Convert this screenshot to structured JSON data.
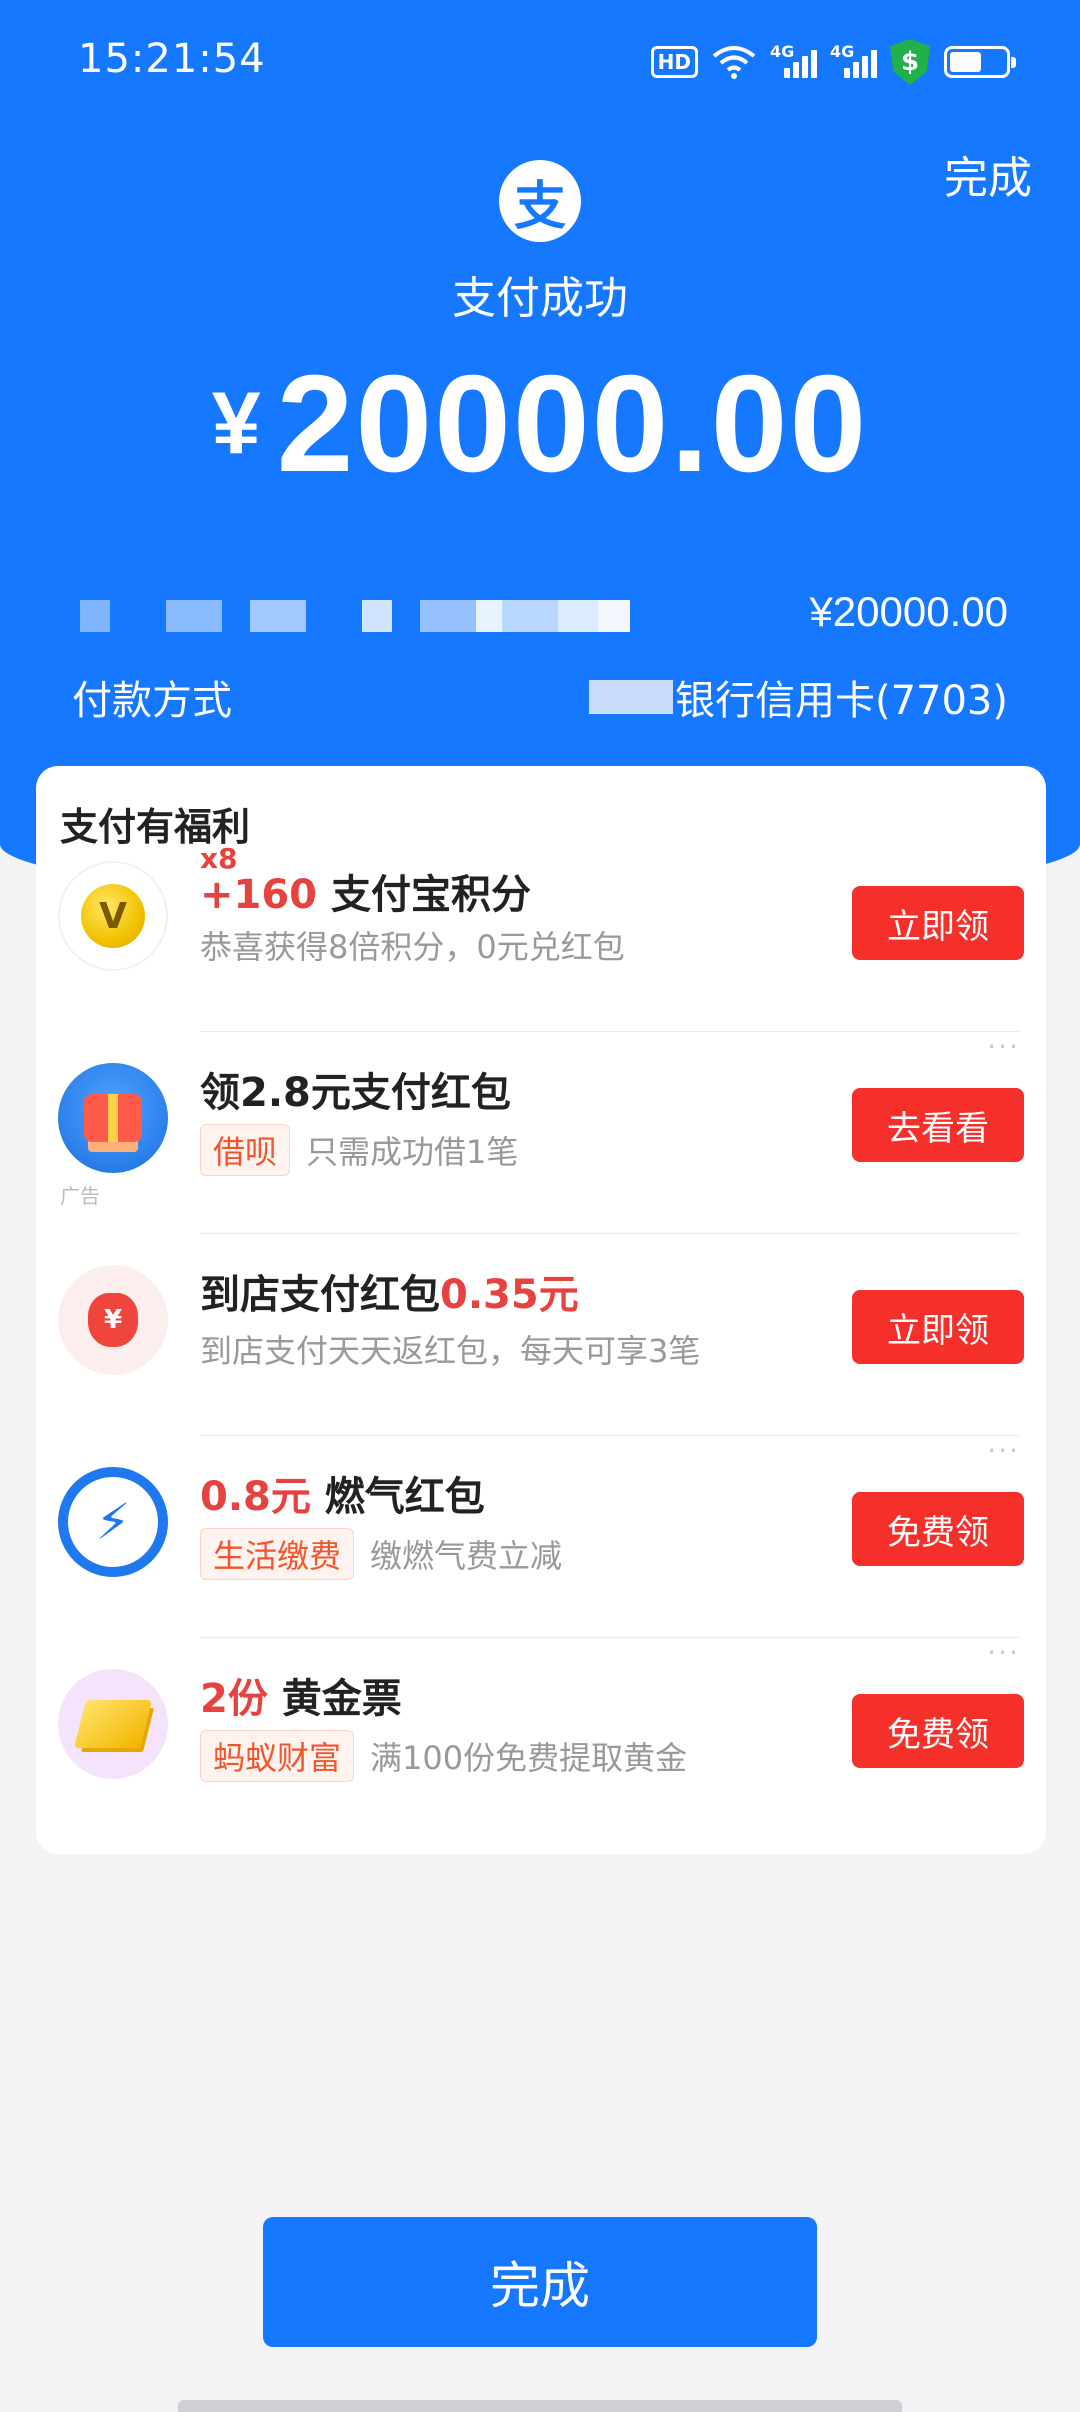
{
  "status_bar": {
    "time": "15:21:54",
    "hd": "HD",
    "net1": "4G",
    "net2": "4G",
    "shield_symbol": "$",
    "icons": [
      "hd-icon",
      "wifi-icon",
      "signal-4g-icon",
      "signal-4g-icon",
      "security-shield-icon",
      "battery-icon"
    ]
  },
  "header": {
    "done_label": "完成",
    "logo_char": "支",
    "title": "支付成功",
    "currency": "¥",
    "amount": "20000.00"
  },
  "details": {
    "order_amount": "¥20000.00",
    "payment_method_label": "付款方式",
    "payment_method_value": "银行信用卡(7703)"
  },
  "benefits": {
    "title": "支付有福利",
    "items": [
      {
        "badge": "x8",
        "highlight": "+160",
        "title": "支付宝积分",
        "subtitle": "恭喜获得8倍积分，0元兑红包",
        "button": "立即领",
        "icon": "points-coin-icon",
        "icon_char": "V"
      },
      {
        "title": "领2.8元支付红包",
        "tag": "借呗",
        "subtitle": "只需成功借1笔",
        "button": "去看看",
        "icon": "gift-box-icon",
        "ad_label": "广告",
        "more": "···"
      },
      {
        "title": "到店支付红包",
        "highlight": "0.35元",
        "subtitle": "到店支付天天返红包，每天可享3笔",
        "button": "立即领",
        "icon": "red-envelope-icon",
        "icon_char": "¥"
      },
      {
        "highlight": "0.8元",
        "title": "燃气红包",
        "tag": "生活缴费",
        "subtitle": "缴燃气费立减",
        "button": "免费领",
        "icon": "lightning-icon",
        "icon_char": "⚡",
        "more": "···"
      },
      {
        "highlight": "2份",
        "title": "黄金票",
        "tag": "蚂蚁财富",
        "subtitle": "满100份免费提取黄金",
        "button": "免费领",
        "icon": "gold-bar-icon",
        "more": "···"
      }
    ]
  },
  "footer": {
    "done_label": "完成"
  },
  "colors": {
    "primary": "#1677ff",
    "button_red": "#f5302b",
    "highlight_red": "#e64340",
    "tag_orange": "#f2552c"
  }
}
